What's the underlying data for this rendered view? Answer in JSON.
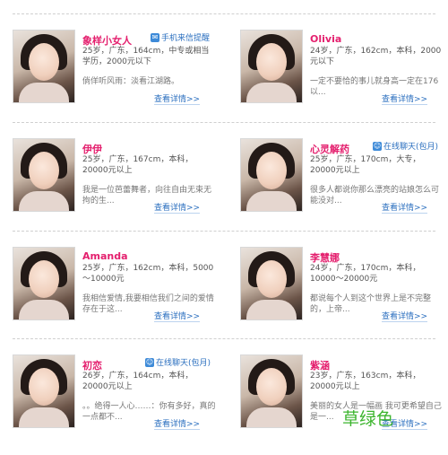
{
  "detail_link": "查看详情>>",
  "watermark": "草绿色",
  "cards": [
    {
      "name": "象样小女人",
      "badge": "手机来信提醒",
      "info": "25岁，广东，164cm，中专或相当学历，2000元以下",
      "desc": "倘佯听风雨：淡看江湖路。"
    },
    {
      "name": "Olivia",
      "badge": "",
      "info": "24岁，广东，162cm，本科，2000元以下",
      "desc": "一定不要恰的事儿就身高一定在176以..."
    },
    {
      "name": "伊伊",
      "badge": "",
      "info": "25岁，广东，167cm，本科，20000元以上",
      "desc": "我是一位芭蕾舞者，向往自由无束无拘的生..."
    },
    {
      "name": "心灵解药",
      "badge": "在线聊天(包月)",
      "info": "25岁，广东，170cm，大专，20000元以上",
      "desc": "很多人都说你那么漂亮的站娘怎么可能没对..."
    },
    {
      "name": "Amanda",
      "badge": "",
      "info": "25岁，广东，162cm，本科，5000～10000元",
      "desc": "我相信爱情,我要相信我们之间的爱情存在于这..."
    },
    {
      "name": "李慧娜",
      "badge": "",
      "info": "24岁，广东，170cm，本科，10000～20000元",
      "desc": "都说每个人到这个世界上是不完整的，上帝..."
    },
    {
      "name": "初恋",
      "badge": "在线聊天(包月)",
      "info": "26岁，广东，164cm，本科，20000元以上",
      "desc": "。。绝得一人心……：你有多好，真的一点都不..."
    },
    {
      "name": "紫涵",
      "badge": "",
      "info": "23岁，广东，163cm，本科，20000元以上",
      "desc": "美丽的女人是一幅画 我可更希望自己是一..."
    }
  ]
}
